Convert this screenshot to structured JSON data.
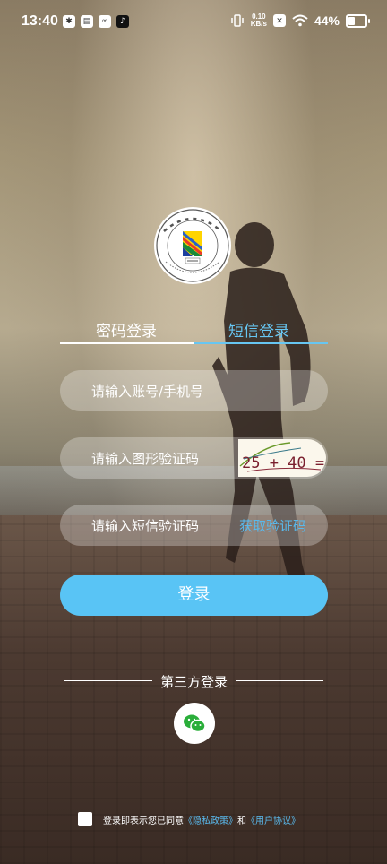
{
  "status_bar": {
    "time": "13:40",
    "speed_value": "0.10",
    "speed_unit": "KB/s",
    "battery_percent": "44%",
    "battery_level": 0.44,
    "icons": [
      "weather-icon",
      "calendar-icon",
      "link-icon",
      "tiktok-icon",
      "vibrate-icon",
      "data-speed",
      "sim-off-icon",
      "wifi-icon",
      "battery-icon"
    ]
  },
  "tabs": {
    "password_login": "密码登录",
    "sms_login": "短信登录",
    "active": "sms_login"
  },
  "form": {
    "account_placeholder": "请输入账号/手机号",
    "captcha_placeholder": "请输入图形验证码",
    "captcha_text": "25 + 40 =",
    "sms_code_placeholder": "请输入短信验证码",
    "get_code_label": "获取验证码"
  },
  "login_button": "登录",
  "third_party": {
    "label": "第三方登录",
    "providers": [
      "wechat"
    ]
  },
  "agreement": {
    "prefix": "登录即表示您已同意",
    "privacy_policy": "《隐私政策》",
    "conjunction": "和",
    "user_agreement": "《用户协议》",
    "checked": false
  },
  "colors": {
    "accent": "#59c4f5",
    "link": "#59b9ec"
  }
}
